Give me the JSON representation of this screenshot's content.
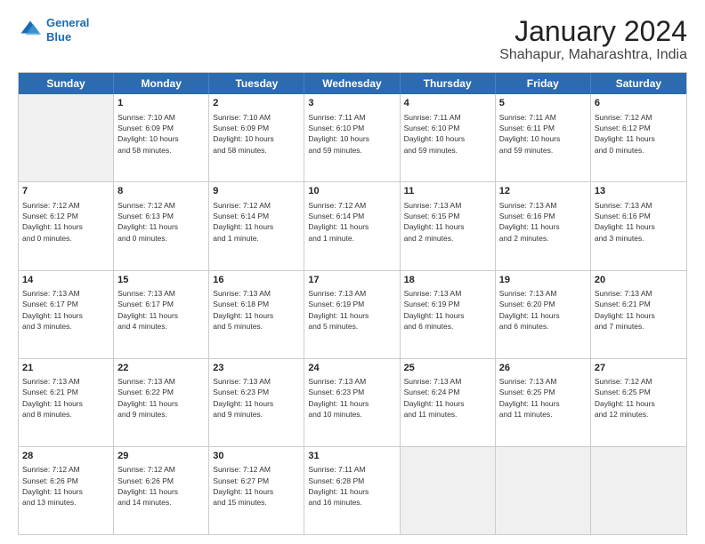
{
  "header": {
    "logo_line1": "General",
    "logo_line2": "Blue",
    "month": "January 2024",
    "location": "Shahapur, Maharashtra, India"
  },
  "weekdays": [
    "Sunday",
    "Monday",
    "Tuesday",
    "Wednesday",
    "Thursday",
    "Friday",
    "Saturday"
  ],
  "weeks": [
    [
      {
        "day": "",
        "lines": [],
        "shaded": true
      },
      {
        "day": "1",
        "lines": [
          "Sunrise: 7:10 AM",
          "Sunset: 6:09 PM",
          "Daylight: 10 hours",
          "and 58 minutes."
        ]
      },
      {
        "day": "2",
        "lines": [
          "Sunrise: 7:10 AM",
          "Sunset: 6:09 PM",
          "Daylight: 10 hours",
          "and 58 minutes."
        ]
      },
      {
        "day": "3",
        "lines": [
          "Sunrise: 7:11 AM",
          "Sunset: 6:10 PM",
          "Daylight: 10 hours",
          "and 59 minutes."
        ]
      },
      {
        "day": "4",
        "lines": [
          "Sunrise: 7:11 AM",
          "Sunset: 6:10 PM",
          "Daylight: 10 hours",
          "and 59 minutes."
        ]
      },
      {
        "day": "5",
        "lines": [
          "Sunrise: 7:11 AM",
          "Sunset: 6:11 PM",
          "Daylight: 10 hours",
          "and 59 minutes."
        ]
      },
      {
        "day": "6",
        "lines": [
          "Sunrise: 7:12 AM",
          "Sunset: 6:12 PM",
          "Daylight: 11 hours",
          "and 0 minutes."
        ]
      }
    ],
    [
      {
        "day": "7",
        "lines": [
          "Sunrise: 7:12 AM",
          "Sunset: 6:12 PM",
          "Daylight: 11 hours",
          "and 0 minutes."
        ]
      },
      {
        "day": "8",
        "lines": [
          "Sunrise: 7:12 AM",
          "Sunset: 6:13 PM",
          "Daylight: 11 hours",
          "and 0 minutes."
        ]
      },
      {
        "day": "9",
        "lines": [
          "Sunrise: 7:12 AM",
          "Sunset: 6:14 PM",
          "Daylight: 11 hours",
          "and 1 minute."
        ]
      },
      {
        "day": "10",
        "lines": [
          "Sunrise: 7:12 AM",
          "Sunset: 6:14 PM",
          "Daylight: 11 hours",
          "and 1 minute."
        ]
      },
      {
        "day": "11",
        "lines": [
          "Sunrise: 7:13 AM",
          "Sunset: 6:15 PM",
          "Daylight: 11 hours",
          "and 2 minutes."
        ]
      },
      {
        "day": "12",
        "lines": [
          "Sunrise: 7:13 AM",
          "Sunset: 6:16 PM",
          "Daylight: 11 hours",
          "and 2 minutes."
        ]
      },
      {
        "day": "13",
        "lines": [
          "Sunrise: 7:13 AM",
          "Sunset: 6:16 PM",
          "Daylight: 11 hours",
          "and 3 minutes."
        ]
      }
    ],
    [
      {
        "day": "14",
        "lines": [
          "Sunrise: 7:13 AM",
          "Sunset: 6:17 PM",
          "Daylight: 11 hours",
          "and 3 minutes."
        ]
      },
      {
        "day": "15",
        "lines": [
          "Sunrise: 7:13 AM",
          "Sunset: 6:17 PM",
          "Daylight: 11 hours",
          "and 4 minutes."
        ]
      },
      {
        "day": "16",
        "lines": [
          "Sunrise: 7:13 AM",
          "Sunset: 6:18 PM",
          "Daylight: 11 hours",
          "and 5 minutes."
        ]
      },
      {
        "day": "17",
        "lines": [
          "Sunrise: 7:13 AM",
          "Sunset: 6:19 PM",
          "Daylight: 11 hours",
          "and 5 minutes."
        ]
      },
      {
        "day": "18",
        "lines": [
          "Sunrise: 7:13 AM",
          "Sunset: 6:19 PM",
          "Daylight: 11 hours",
          "and 6 minutes."
        ]
      },
      {
        "day": "19",
        "lines": [
          "Sunrise: 7:13 AM",
          "Sunset: 6:20 PM",
          "Daylight: 11 hours",
          "and 6 minutes."
        ]
      },
      {
        "day": "20",
        "lines": [
          "Sunrise: 7:13 AM",
          "Sunset: 6:21 PM",
          "Daylight: 11 hours",
          "and 7 minutes."
        ]
      }
    ],
    [
      {
        "day": "21",
        "lines": [
          "Sunrise: 7:13 AM",
          "Sunset: 6:21 PM",
          "Daylight: 11 hours",
          "and 8 minutes."
        ]
      },
      {
        "day": "22",
        "lines": [
          "Sunrise: 7:13 AM",
          "Sunset: 6:22 PM",
          "Daylight: 11 hours",
          "and 9 minutes."
        ]
      },
      {
        "day": "23",
        "lines": [
          "Sunrise: 7:13 AM",
          "Sunset: 6:23 PM",
          "Daylight: 11 hours",
          "and 9 minutes."
        ]
      },
      {
        "day": "24",
        "lines": [
          "Sunrise: 7:13 AM",
          "Sunset: 6:23 PM",
          "Daylight: 11 hours",
          "and 10 minutes."
        ]
      },
      {
        "day": "25",
        "lines": [
          "Sunrise: 7:13 AM",
          "Sunset: 6:24 PM",
          "Daylight: 11 hours",
          "and 11 minutes."
        ]
      },
      {
        "day": "26",
        "lines": [
          "Sunrise: 7:13 AM",
          "Sunset: 6:25 PM",
          "Daylight: 11 hours",
          "and 11 minutes."
        ]
      },
      {
        "day": "27",
        "lines": [
          "Sunrise: 7:12 AM",
          "Sunset: 6:25 PM",
          "Daylight: 11 hours",
          "and 12 minutes."
        ]
      }
    ],
    [
      {
        "day": "28",
        "lines": [
          "Sunrise: 7:12 AM",
          "Sunset: 6:26 PM",
          "Daylight: 11 hours",
          "and 13 minutes."
        ]
      },
      {
        "day": "29",
        "lines": [
          "Sunrise: 7:12 AM",
          "Sunset: 6:26 PM",
          "Daylight: 11 hours",
          "and 14 minutes."
        ]
      },
      {
        "day": "30",
        "lines": [
          "Sunrise: 7:12 AM",
          "Sunset: 6:27 PM",
          "Daylight: 11 hours",
          "and 15 minutes."
        ]
      },
      {
        "day": "31",
        "lines": [
          "Sunrise: 7:11 AM",
          "Sunset: 6:28 PM",
          "Daylight: 11 hours",
          "and 16 minutes."
        ]
      },
      {
        "day": "",
        "lines": [],
        "shaded": true
      },
      {
        "day": "",
        "lines": [],
        "shaded": true
      },
      {
        "day": "",
        "lines": [],
        "shaded": true
      }
    ]
  ]
}
